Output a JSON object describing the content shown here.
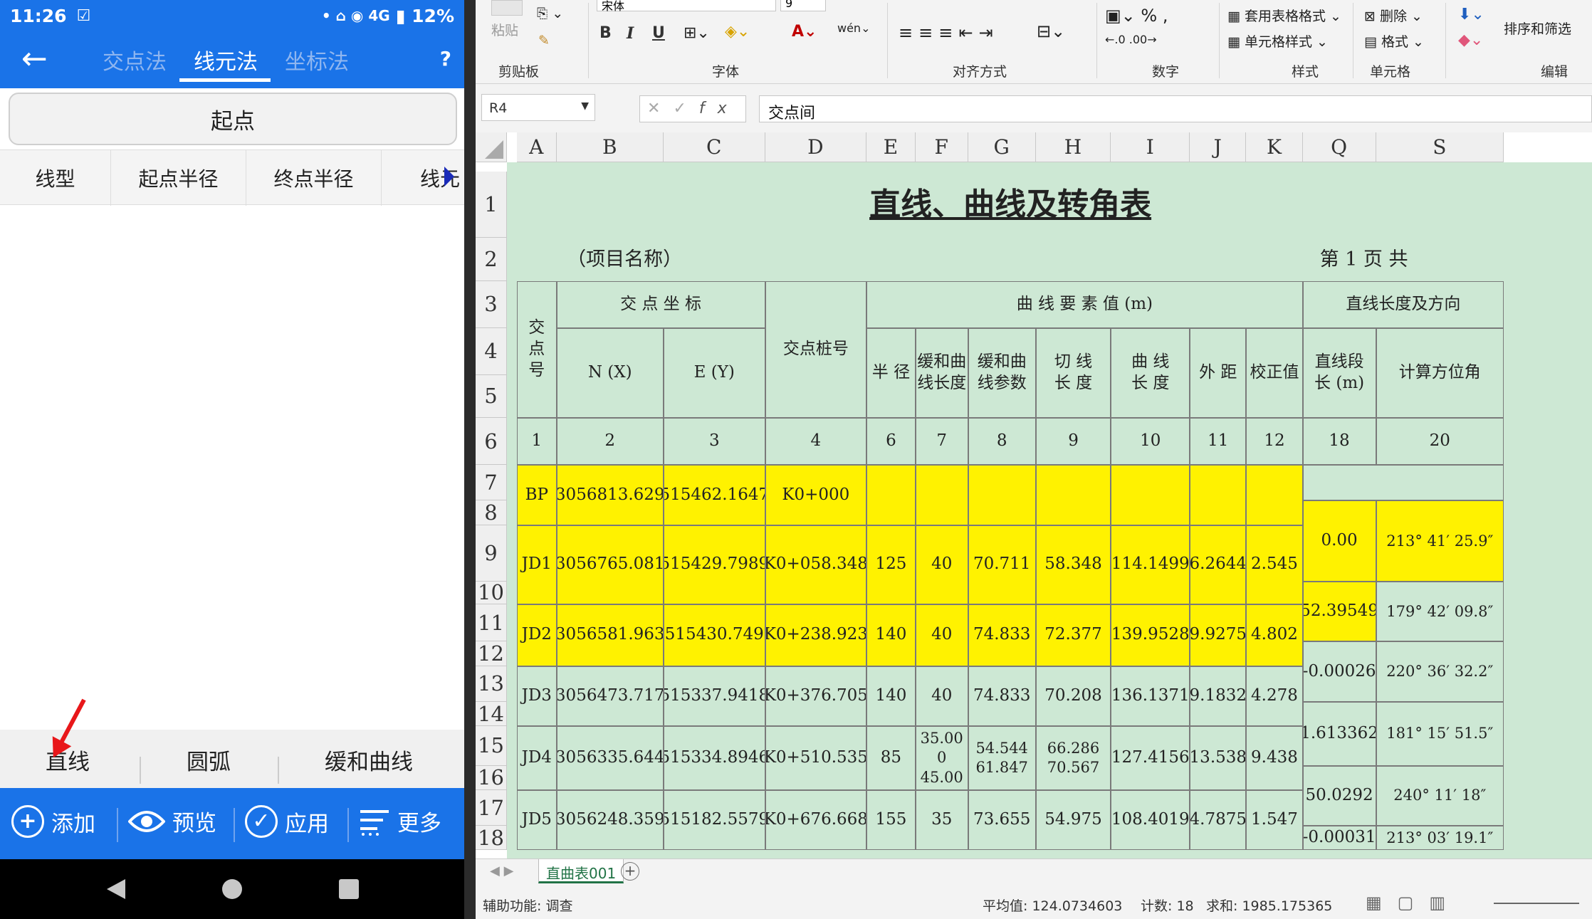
{
  "phone": {
    "time": "11:26",
    "status_icons": "• ⌂ ◉ 4G",
    "battery": "▮ 12%",
    "tabs": [
      "交点法",
      "线元法",
      "坐标法"
    ],
    "help": "?",
    "start_label": "起点",
    "columns": [
      "线型",
      "起点半径",
      "终点半径",
      "线元"
    ],
    "segments": [
      "直线",
      "圆弧",
      "缓和曲线"
    ],
    "actions": [
      "添加",
      "预览",
      "应用",
      "更多"
    ]
  },
  "excel": {
    "ribbon": {
      "paste": "粘贴",
      "groups": [
        "剪贴板",
        "字体",
        "对齐方式",
        "数字",
        "样式",
        "单元格",
        "编辑"
      ],
      "font_name": "宋体",
      "font_size": "9",
      "styles": [
        "套用表格格式",
        "单元格样式"
      ],
      "cells": [
        "删除",
        "格式"
      ],
      "sort": "排序和筛选"
    },
    "name_box": "R4",
    "formula": "交点间",
    "col_letters": [
      "A",
      "B",
      "C",
      "D",
      "E",
      "F",
      "G",
      "H",
      "I",
      "J",
      "K",
      "Q",
      "S"
    ],
    "row_numbers": [
      "1",
      "2",
      "3",
      "4",
      "5",
      "6",
      "7",
      "8",
      "9",
      "10",
      "11",
      "12",
      "13",
      "14",
      "15",
      "16",
      "17",
      "18"
    ],
    "title": "直线、曲线及转角表",
    "project": "（项目名称）",
    "page": "第 1 页  共",
    "head": {
      "jd": "交\n点\n号",
      "coord": "交 点 坐 标",
      "nx": "N (X)",
      "ey": "E (Y)",
      "pile": "交点桩号",
      "curve": "曲  线  要  素  值  (m)",
      "line": "直线长度及方向",
      "radius": "半 径",
      "tlen": "缓和曲\n线长度",
      "tparam": "缓和曲\n线参数",
      "tangent": "切 线\n长 度",
      "clen": "曲 线\n长 度",
      "ext": "外 距",
      "corr": "校正值",
      "seglen": "直线段\n长 (m)",
      "azimuth": "计算方位角"
    },
    "col_nums": [
      "1",
      "2",
      "3",
      "4",
      "6",
      "7",
      "8",
      "9",
      "10",
      "11",
      "12",
      "18",
      "20"
    ],
    "rows": [
      {
        "jd": "BP",
        "n": "3056813.629",
        "e": "515462.1647",
        "pile": "K0+000",
        "r": "",
        "ls": "",
        "a": "",
        "t": "",
        "l": "",
        "ext": "",
        "q": ""
      },
      {
        "jd": "JD1",
        "n": "3056765.081",
        "e": "515429.7989",
        "pile": "K0+058.348",
        "r": "125",
        "ls": "40",
        "a": "70.711",
        "t": "58.348",
        "l": "114.1499",
        "ext": "6.2644",
        "q": "2.545"
      },
      {
        "jd": "JD2",
        "n": "3056581.963",
        "e": "515430.749",
        "pile": "K0+238.923",
        "r": "140",
        "ls": "40",
        "a": "74.833",
        "t": "72.377",
        "l": "139.9528",
        "ext": "9.9275",
        "q": "4.802"
      },
      {
        "jd": "JD3",
        "n": "3056473.717",
        "e": "515337.9418",
        "pile": "K0+376.705",
        "r": "140",
        "ls": "40",
        "a": "74.833",
        "t": "70.208",
        "l": "136.1371",
        "ext": "9.1832",
        "q": "4.278"
      },
      {
        "jd": "JD4",
        "n": "3056335.644",
        "e": "515334.8946",
        "pile": "K0+510.535",
        "r": "85",
        "ls": "35.00\n0\n45.00",
        "a": "54.544\n61.847",
        "t": "66.286\n70.567",
        "l": "127.4156",
        "ext": "13.538",
        "q": "9.438"
      },
      {
        "jd": "JD5",
        "n": "3056248.359",
        "e": "515182.5579",
        "pile": "K0+676.668",
        "r": "155",
        "ls": "35",
        "a": "73.655",
        "t": "54.975",
        "l": "108.4019",
        "ext": "4.7875",
        "q": "1.547"
      }
    ],
    "lines": [
      {
        "len": "0.00",
        "az": "213° 41′ 25.9″"
      },
      {
        "len": "52.39549",
        "az": "179° 42′ 09.8″"
      },
      {
        "len": "-0.00026",
        "az": "220° 36′ 32.2″"
      },
      {
        "len": "1.613362",
        "az": "181° 15′ 51.5″"
      },
      {
        "len": "50.0292",
        "az": "240° 11′ 18″"
      },
      {
        "len": "-0.00031",
        "az": "213° 03′ 19.1″"
      }
    ],
    "sheet_tab": "直曲表001",
    "status": {
      "accessibility": "辅助功能: 调查",
      "average": "平均值: 124.0734603",
      "count": "计数: 18",
      "sum": "求和: 1985.175365"
    }
  }
}
